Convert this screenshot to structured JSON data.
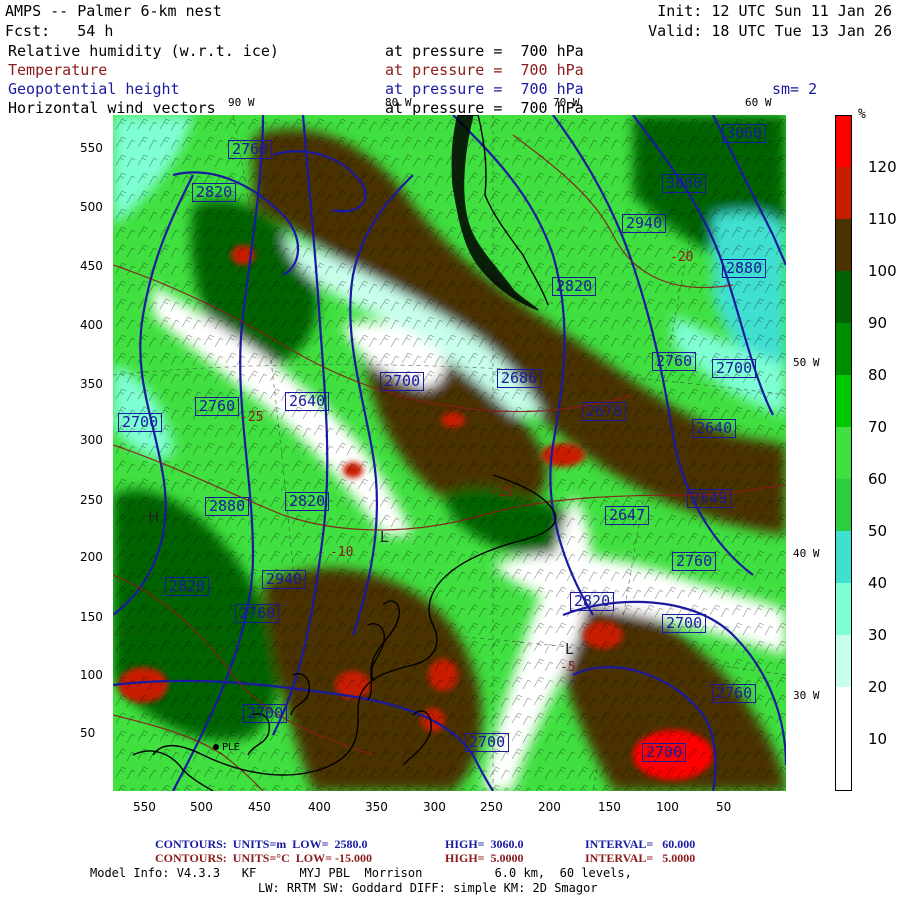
{
  "header": {
    "model": "AMPS -- Palmer 6-km nest",
    "forecast": "Fcst:   54 h",
    "init": "Init: 12 UTC Sun 11 Jan 26",
    "valid": "Valid: 18 UTC Tue 13 Jan 26"
  },
  "fields": [
    {
      "name": "Relative humidity (w.r.t. ice)",
      "level": "at pressure =  700 hPa",
      "color": "#000000"
    },
    {
      "name": "Temperature",
      "level": "at pressure =  700 hPa",
      "color": "#8b1a1a"
    },
    {
      "name": "Geopotential height",
      "level": "at pressure =  700 hPa",
      "color": "#1a1aa0"
    },
    {
      "name": "Horizontal wind vectors",
      "level": "at pressure =  700 hPa",
      "color": "#000000"
    }
  ],
  "smoothing": "sm= 2",
  "map": {
    "meridian_labels_top": [
      "90 W",
      "80 W",
      "70 W",
      "60 W"
    ],
    "meridian_labels_right": [
      "50 W",
      "40 W",
      "30 W"
    ],
    "x_ticks": [
      "550",
      "500",
      "450",
      "400",
      "350",
      "300",
      "250",
      "200",
      "150",
      "100",
      "50"
    ],
    "y_ticks": [
      "550",
      "500",
      "450",
      "400",
      "350",
      "300",
      "250",
      "200",
      "150",
      "100",
      "50"
    ],
    "height_contours": [
      "3060",
      "3000",
      "2940",
      "2880",
      "2820",
      "2760",
      "2700",
      "2640",
      "2686",
      "2670",
      "2649",
      "2647",
      "2760",
      "2820",
      "2700",
      "2760",
      "2700",
      "2640",
      "2760",
      "2700",
      "2820",
      "2880",
      "2940",
      "2820",
      "2760",
      "2700",
      "2700",
      "2700",
      "2760",
      "2820"
    ],
    "temp_labels": [
      "-20",
      "-25",
      "-15",
      "-10",
      "-5"
    ],
    "point_markers": [
      "H",
      "L",
      "L"
    ],
    "station": "PLE",
    "colors": {
      "rh_10_20": "#ffffff",
      "rh_30": "#c8ffec",
      "rh_40": "#7fffd4",
      "rh_50": "#40e0d0",
      "rh_60": "#2ecc40",
      "rh_70": "#40e040",
      "rh_80": "#00c800",
      "rh_90": "#008c00",
      "rh_100": "#006400",
      "rh_110": "#4a3300",
      "rh_120": "#c81e00",
      "rh_max": "#ff0000",
      "height_line": "#1a1aa0",
      "temp_line": "#8b1a1a"
    }
  },
  "colorbar": {
    "unit": "%",
    "labels": [
      "120",
      "110",
      "100",
      "90",
      "80",
      "70",
      "60",
      "50",
      "40",
      "30",
      "20",
      "10"
    ],
    "colors": [
      "#ff0000",
      "#c81e00",
      "#4a3300",
      "#006400",
      "#008c00",
      "#00c800",
      "#40e040",
      "#2ecc40",
      "#40e0d0",
      "#7fffd4",
      "#c8ffec",
      "#ffffff",
      "#ffffff"
    ]
  },
  "footer": {
    "line1_label": "CONTOURS:  UNITS=m  LOW=  2580.0",
    "line1_high": "HIGH=  3060.0",
    "line1_interval": "INTERVAL=   60.000",
    "line2_label": "CONTOURS:  UNITS=°C  LOW= -15.000",
    "line2_high": "HIGH=  5.0000",
    "line2_interval": "INTERVAL=   5.0000",
    "model_info": "Model Info: V4.3.3   KF      MYJ PBL  Morrison          6.0 km,  60 levels,",
    "model_info2": "LW: RRTM SW: Goddard DIFF: simple KM: 2D Smagor"
  }
}
